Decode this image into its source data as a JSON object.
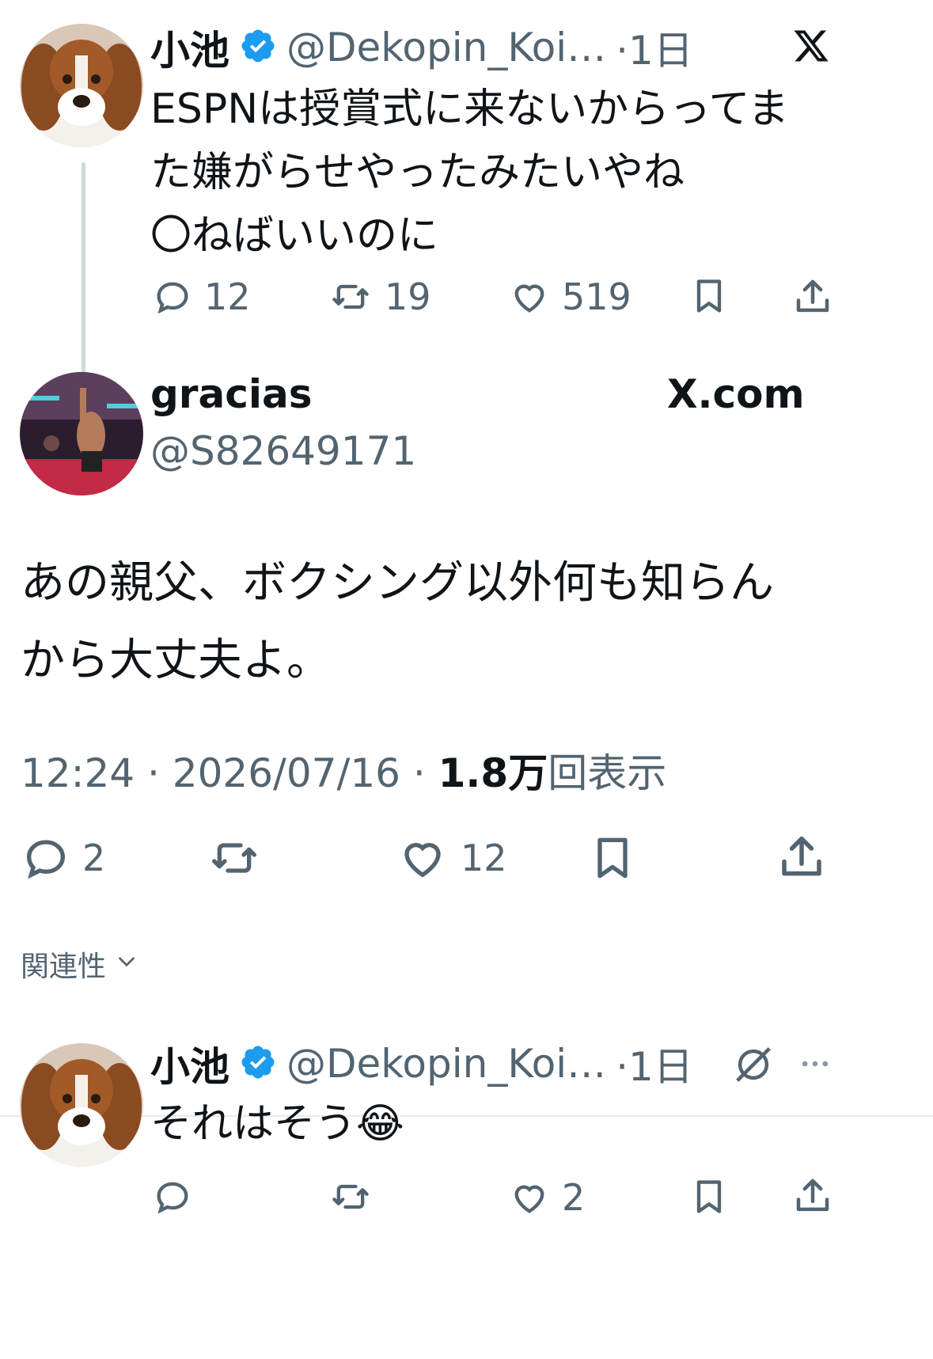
{
  "tweet1": {
    "name": "小池",
    "handle": "@Dekopin_Koi…",
    "time": "·1日",
    "lines": [
      "ESPNは授賞式に来ないからってま",
      "た嫌がらせやったみたいやね",
      "〇ねばいいのに"
    ],
    "replies": "12",
    "retweets": "19",
    "likes": "519"
  },
  "embed": {
    "name": "gracias",
    "handle": "@S82649171",
    "site": "X.com",
    "lines": [
      "あの親父、ボクシング以外何も知らん",
      "から大丈夫よ。"
    ],
    "time": "12:24 · 2026/07/16 · ",
    "views_count": "1.8万",
    "views_label": "回表示",
    "replies": "2",
    "likes": "12"
  },
  "sort": {
    "label": "関連性"
  },
  "tweet2": {
    "name": "小池",
    "handle": "@Dekopin_Koi…",
    "time": "·1日",
    "text": "それはそう",
    "emoji": "😂",
    "likes": "2"
  },
  "colors": {
    "verified": "#1d9bf0",
    "muted": "#536471",
    "text": "#0f1419"
  },
  "icons": [
    "x-logo-icon",
    "verified-badge-icon",
    "reply-icon",
    "retweet-icon",
    "like-icon",
    "bookmark-icon",
    "share-icon",
    "chevron-down-icon",
    "grok-icon",
    "more-icon"
  ]
}
